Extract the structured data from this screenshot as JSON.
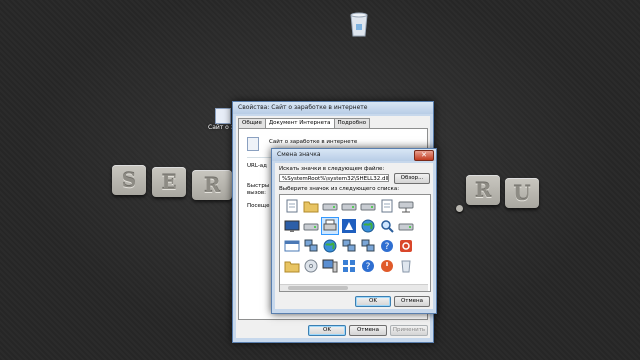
{
  "desktop": {
    "shortcut_label": "Сайт о заработке",
    "logo_letters": [
      "S",
      "E",
      "R",
      "U"
    ],
    "logo_dot": "."
  },
  "properties_dialog": {
    "title": "Свойства: Сайт о заработке в интернете",
    "tabs": [
      {
        "label": "Общие"
      },
      {
        "label": "Документ Интернета"
      },
      {
        "label": "Подробно"
      }
    ],
    "header_name": "Сайт о заработке в интернете",
    "url_label": "URL-ад",
    "shortcut_label": "Быстры вызов:",
    "visits_label": "Посеще",
    "ok": "OK",
    "cancel": "Отмена",
    "apply": "Применить"
  },
  "change_icon_dialog": {
    "title": "Смена значка",
    "search_label": "Искать значки в следующем файле:",
    "file_path": "%SystemRoot%\\system32\\SHELL32.dll",
    "browse": "Обзор...",
    "select_label": "Выберите значок из следующего списка:",
    "ok": "OK",
    "cancel": "Отмена",
    "close_glyph": "✕",
    "selected_index": 9,
    "icons": [
      "document-icon",
      "folder-icon",
      "drive-icon",
      "drive-icon",
      "drive-icon",
      "document-icon",
      "network-drive-icon",
      "monitor-icon",
      "drive-icon",
      "printer-icon",
      "shortcut-icon",
      "globe-icon",
      "search-icon",
      "drive-icon",
      "window-icon",
      "network-icon",
      "globe-icon",
      "network-icon",
      "network-icon",
      "help-icon",
      "shutdown-icon",
      "folder-icon",
      "cd-icon",
      "computer-icon",
      "grid-icon",
      "help-icon",
      "power-icon",
      "recycle-icon"
    ]
  },
  "colors": {
    "window_frame": "#c7d8ec",
    "close_red": "#c33c22",
    "selection": "#cce6ff"
  }
}
